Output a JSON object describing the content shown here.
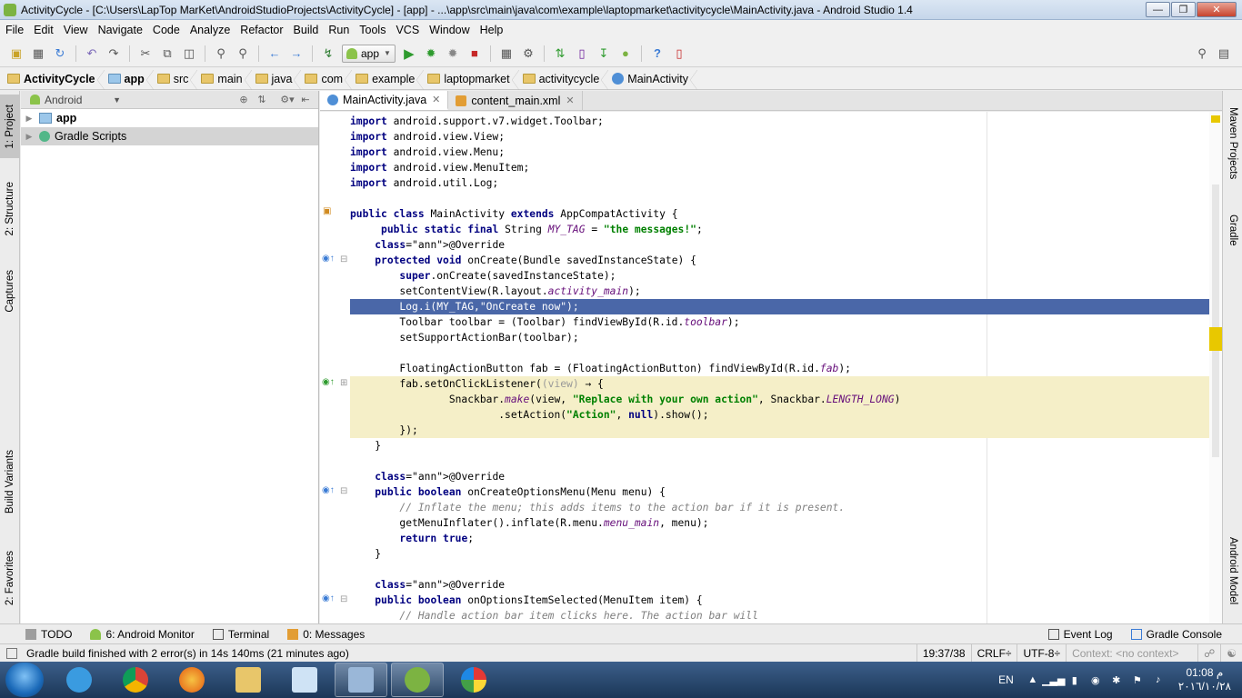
{
  "window": {
    "title": "ActivityCycle - [C:\\Users\\LapTop MarKet\\AndroidStudioProjects\\ActivityCycle] - [app] - ...\\app\\src\\main\\java\\com\\example\\laptopmarket\\activitycycle\\MainActivity.java - Android Studio 1.4"
  },
  "menu": [
    "File",
    "Edit",
    "View",
    "Navigate",
    "Code",
    "Analyze",
    "Refactor",
    "Build",
    "Run",
    "Tools",
    "VCS",
    "Window",
    "Help"
  ],
  "toolbar": {
    "run_config": "app"
  },
  "breadcrumbs": [
    "ActivityCycle",
    "app",
    "src",
    "main",
    "java",
    "com",
    "example",
    "laptopmarket",
    "activitycycle",
    "MainActivity"
  ],
  "left_tabs": [
    "1: Project",
    "2: Structure",
    "Captures",
    "Build Variants",
    "2: Favorites"
  ],
  "right_tabs": [
    "Maven Projects",
    "Gradle",
    "Android Model"
  ],
  "project_panel": {
    "view": "Android",
    "items": [
      {
        "label": "app",
        "bold": true
      },
      {
        "label": "Gradle Scripts",
        "bold": false
      }
    ]
  },
  "editor_tabs": [
    {
      "label": "MainActivity.java",
      "active": true
    },
    {
      "label": "content_main.xml",
      "active": false
    }
  ],
  "code_lines": [
    "import android.support.v7.widget.Toolbar;",
    "import android.view.View;",
    "import android.view.Menu;",
    "import android.view.MenuItem;",
    "import android.util.Log;",
    "",
    "public class MainActivity extends AppCompatActivity {",
    "     public static final String MY_TAG = \"the messages!\";",
    "    @Override",
    "    protected void onCreate(Bundle savedInstanceState) {",
    "        super.onCreate(savedInstanceState);",
    "        setContentView(R.layout.activity_main);",
    "        Log.i(MY_TAG,\"OnCreate now\");",
    "        Toolbar toolbar = (Toolbar) findViewById(R.id.toolbar);",
    "        setSupportActionBar(toolbar);",
    "",
    "        FloatingActionButton fab = (FloatingActionButton) findViewById(R.id.fab);",
    "        fab.setOnClickListener((view) → {",
    "                Snackbar.make(view, \"Replace with your own action\", Snackbar.LENGTH_LONG)",
    "                        .setAction(\"Action\", null).show();",
    "        });",
    "    }",
    "",
    "    @Override",
    "    public boolean onCreateOptionsMenu(Menu menu) {",
    "        // Inflate the menu; this adds items to the action bar if it is present.",
    "        getMenuInflater().inflate(R.menu.menu_main, menu);",
    "        return true;",
    "    }",
    "",
    "    @Override",
    "    public boolean onOptionsItemSelected(MenuItem item) {",
    "        // Handle action bar item clicks here. The action bar will"
  ],
  "bottom_tools": {
    "left": [
      "TODO",
      "6: Android Monitor",
      "Terminal",
      "0: Messages"
    ],
    "right": [
      "Event Log",
      "Gradle Console"
    ]
  },
  "status": {
    "message": "Gradle build finished with 2 error(s) in 14s 140ms (21 minutes ago)",
    "position": "19:37/38",
    "line_sep": "CRLF÷",
    "encoding": "UTF-8÷",
    "context": "Context: <no context>"
  },
  "taskbar": {
    "lang": "EN",
    "time": "01:08 م",
    "date": "٢٠١٦/١٠/٢٨"
  },
  "colors": {
    "selection": "#4a67a8",
    "lambda_fold": "#f5efc8",
    "keyword": "#000080",
    "string": "#008000"
  }
}
